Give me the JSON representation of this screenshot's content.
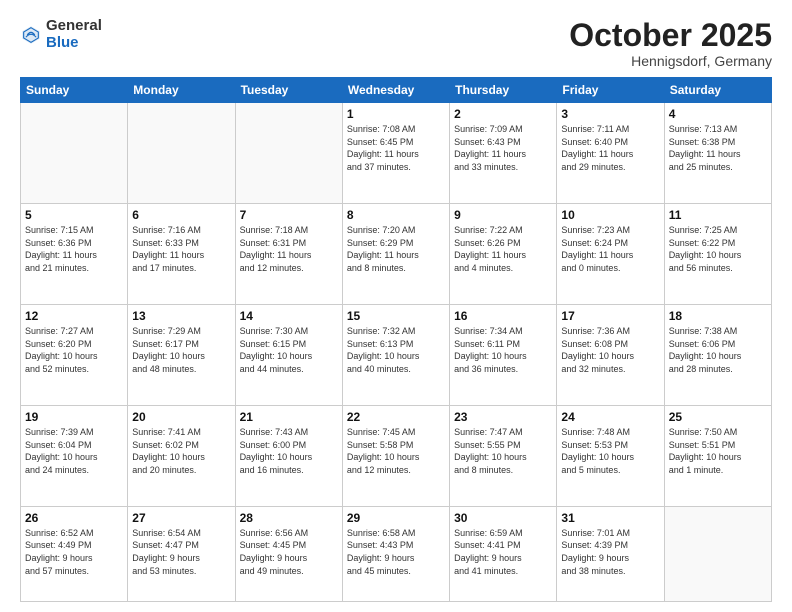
{
  "header": {
    "logo_general": "General",
    "logo_blue": "Blue",
    "month_title": "October 2025",
    "location": "Hennigsdorf, Germany"
  },
  "weekdays": [
    "Sunday",
    "Monday",
    "Tuesday",
    "Wednesday",
    "Thursday",
    "Friday",
    "Saturday"
  ],
  "weeks": [
    [
      {
        "day": "",
        "info": ""
      },
      {
        "day": "",
        "info": ""
      },
      {
        "day": "",
        "info": ""
      },
      {
        "day": "1",
        "info": "Sunrise: 7:08 AM\nSunset: 6:45 PM\nDaylight: 11 hours\nand 37 minutes."
      },
      {
        "day": "2",
        "info": "Sunrise: 7:09 AM\nSunset: 6:43 PM\nDaylight: 11 hours\nand 33 minutes."
      },
      {
        "day": "3",
        "info": "Sunrise: 7:11 AM\nSunset: 6:40 PM\nDaylight: 11 hours\nand 29 minutes."
      },
      {
        "day": "4",
        "info": "Sunrise: 7:13 AM\nSunset: 6:38 PM\nDaylight: 11 hours\nand 25 minutes."
      }
    ],
    [
      {
        "day": "5",
        "info": "Sunrise: 7:15 AM\nSunset: 6:36 PM\nDaylight: 11 hours\nand 21 minutes."
      },
      {
        "day": "6",
        "info": "Sunrise: 7:16 AM\nSunset: 6:33 PM\nDaylight: 11 hours\nand 17 minutes."
      },
      {
        "day": "7",
        "info": "Sunrise: 7:18 AM\nSunset: 6:31 PM\nDaylight: 11 hours\nand 12 minutes."
      },
      {
        "day": "8",
        "info": "Sunrise: 7:20 AM\nSunset: 6:29 PM\nDaylight: 11 hours\nand 8 minutes."
      },
      {
        "day": "9",
        "info": "Sunrise: 7:22 AM\nSunset: 6:26 PM\nDaylight: 11 hours\nand 4 minutes."
      },
      {
        "day": "10",
        "info": "Sunrise: 7:23 AM\nSunset: 6:24 PM\nDaylight: 11 hours\nand 0 minutes."
      },
      {
        "day": "11",
        "info": "Sunrise: 7:25 AM\nSunset: 6:22 PM\nDaylight: 10 hours\nand 56 minutes."
      }
    ],
    [
      {
        "day": "12",
        "info": "Sunrise: 7:27 AM\nSunset: 6:20 PM\nDaylight: 10 hours\nand 52 minutes."
      },
      {
        "day": "13",
        "info": "Sunrise: 7:29 AM\nSunset: 6:17 PM\nDaylight: 10 hours\nand 48 minutes."
      },
      {
        "day": "14",
        "info": "Sunrise: 7:30 AM\nSunset: 6:15 PM\nDaylight: 10 hours\nand 44 minutes."
      },
      {
        "day": "15",
        "info": "Sunrise: 7:32 AM\nSunset: 6:13 PM\nDaylight: 10 hours\nand 40 minutes."
      },
      {
        "day": "16",
        "info": "Sunrise: 7:34 AM\nSunset: 6:11 PM\nDaylight: 10 hours\nand 36 minutes."
      },
      {
        "day": "17",
        "info": "Sunrise: 7:36 AM\nSunset: 6:08 PM\nDaylight: 10 hours\nand 32 minutes."
      },
      {
        "day": "18",
        "info": "Sunrise: 7:38 AM\nSunset: 6:06 PM\nDaylight: 10 hours\nand 28 minutes."
      }
    ],
    [
      {
        "day": "19",
        "info": "Sunrise: 7:39 AM\nSunset: 6:04 PM\nDaylight: 10 hours\nand 24 minutes."
      },
      {
        "day": "20",
        "info": "Sunrise: 7:41 AM\nSunset: 6:02 PM\nDaylight: 10 hours\nand 20 minutes."
      },
      {
        "day": "21",
        "info": "Sunrise: 7:43 AM\nSunset: 6:00 PM\nDaylight: 10 hours\nand 16 minutes."
      },
      {
        "day": "22",
        "info": "Sunrise: 7:45 AM\nSunset: 5:58 PM\nDaylight: 10 hours\nand 12 minutes."
      },
      {
        "day": "23",
        "info": "Sunrise: 7:47 AM\nSunset: 5:55 PM\nDaylight: 10 hours\nand 8 minutes."
      },
      {
        "day": "24",
        "info": "Sunrise: 7:48 AM\nSunset: 5:53 PM\nDaylight: 10 hours\nand 5 minutes."
      },
      {
        "day": "25",
        "info": "Sunrise: 7:50 AM\nSunset: 5:51 PM\nDaylight: 10 hours\nand 1 minute."
      }
    ],
    [
      {
        "day": "26",
        "info": "Sunrise: 6:52 AM\nSunset: 4:49 PM\nDaylight: 9 hours\nand 57 minutes."
      },
      {
        "day": "27",
        "info": "Sunrise: 6:54 AM\nSunset: 4:47 PM\nDaylight: 9 hours\nand 53 minutes."
      },
      {
        "day": "28",
        "info": "Sunrise: 6:56 AM\nSunset: 4:45 PM\nDaylight: 9 hours\nand 49 minutes."
      },
      {
        "day": "29",
        "info": "Sunrise: 6:58 AM\nSunset: 4:43 PM\nDaylight: 9 hours\nand 45 minutes."
      },
      {
        "day": "30",
        "info": "Sunrise: 6:59 AM\nSunset: 4:41 PM\nDaylight: 9 hours\nand 41 minutes."
      },
      {
        "day": "31",
        "info": "Sunrise: 7:01 AM\nSunset: 4:39 PM\nDaylight: 9 hours\nand 38 minutes."
      },
      {
        "day": "",
        "info": ""
      }
    ]
  ]
}
